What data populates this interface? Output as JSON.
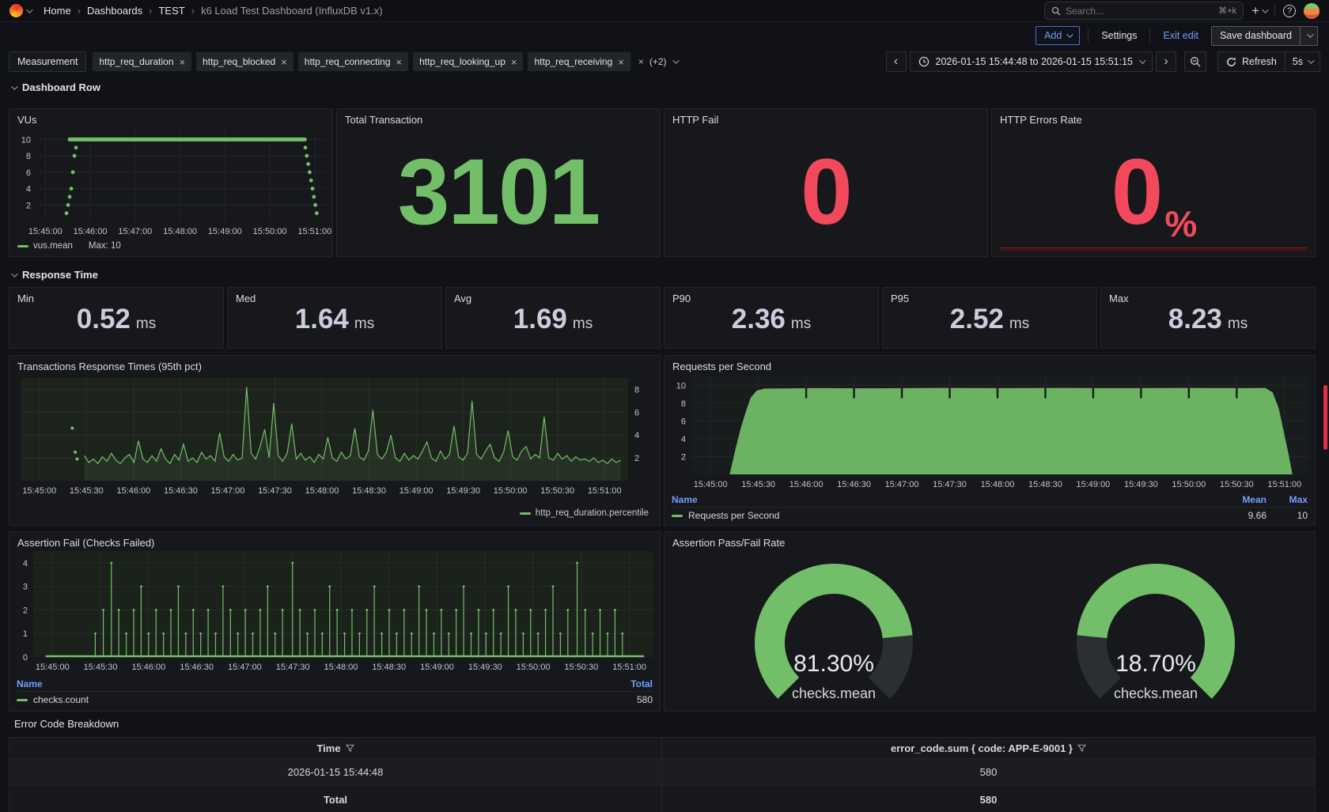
{
  "nav": {
    "breadcrumbs": [
      "Home",
      "Dashboards",
      "TEST",
      "k6 Load Test Dashboard (InfluxDB v1.x)"
    ],
    "search_placeholder": "Search...",
    "search_shortcut": "⌘+k"
  },
  "toolbar": {
    "add_label": "Add",
    "settings_label": "Settings",
    "exit_edit_label": "Exit edit",
    "save_label": "Save dashboard"
  },
  "filters": {
    "measurement_label": "Measurement",
    "chips": [
      "http_req_duration",
      "http_req_blocked",
      "http_req_connecting",
      "http_req_looking_up",
      "http_req_receiving"
    ],
    "more_label": "(+2)"
  },
  "timebar": {
    "range": "2026-01-15 15:44:48 to 2026-01-15 15:51:15",
    "refresh_label": "Refresh",
    "interval_label": "5s"
  },
  "sections": {
    "dashboard_row": "Dashboard Row",
    "response_time": "Response Time",
    "error_breakdown": "Error Code Breakdown"
  },
  "panels": {
    "vus": {
      "title": "VUs",
      "legend": "vus.mean",
      "legend_max": "Max: 10"
    },
    "total_transaction": {
      "title": "Total Transaction",
      "value": "3101"
    },
    "http_fail": {
      "title": "HTTP Fail",
      "value": "0"
    },
    "http_errors": {
      "title": "HTTP Errors Rate",
      "value": "0",
      "unit": "%"
    },
    "stats": [
      {
        "label": "Min",
        "value": "0.52",
        "unit": "ms"
      },
      {
        "label": "Med",
        "value": "1.64",
        "unit": "ms"
      },
      {
        "label": "Avg",
        "value": "1.69",
        "unit": "ms"
      },
      {
        "label": "P90",
        "value": "2.36",
        "unit": "ms"
      },
      {
        "label": "P95",
        "value": "2.52",
        "unit": "ms"
      },
      {
        "label": "Max",
        "value": "8.23",
        "unit": "ms"
      }
    ],
    "transactions": {
      "title": "Transactions Response Times (95th pct)",
      "legend": "http_req_duration.percentile"
    },
    "rps": {
      "title": "Requests per Second",
      "cols": {
        "name": "Name",
        "mean": "Mean",
        "max": "Max"
      },
      "row": {
        "name": "Requests per Second",
        "mean": "9.66",
        "max": "10"
      }
    },
    "assertion_fail": {
      "title": "Assertion Fail (Checks Failed)",
      "cols": {
        "name": "Name",
        "total": "Total"
      },
      "row": {
        "name": "checks.count",
        "total": "580"
      }
    },
    "gauge_panel": {
      "title": "Assertion Pass/Fail Rate",
      "gauges": [
        {
          "display": "81.30%",
          "label": "checks.mean"
        },
        {
          "display": "18.70%",
          "label": "checks.mean"
        }
      ]
    }
  },
  "error_table": {
    "col_time": "Time",
    "col_code": "error_code.sum { code: APP-E-9001 }",
    "row_time": "2026-01-15 15:44:48",
    "row_value": "580",
    "total_label": "Total",
    "total_value": "580"
  },
  "colors": {
    "green": "#73bf69",
    "red": "#f2495c",
    "blue": "#6e9fff"
  },
  "chart_data": [
    {
      "id": "vus",
      "type": "scatter",
      "title": "VUs",
      "x_labels": [
        "15:45:00",
        "15:46:00",
        "15:47:00",
        "15:48:00",
        "15:49:00",
        "15:50:00",
        "15:51:00"
      ],
      "x_start_s": 12,
      "x_step_s": 60,
      "x_total_s": 387,
      "y_ticks": [
        2,
        4,
        6,
        8,
        10
      ],
      "ylim": [
        0,
        11
      ],
      "plateau": {
        "t0": 0.115,
        "t1": 0.927,
        "value": 10
      },
      "ramp_up": {
        "t": 0.104,
        "values": [
          1,
          2,
          3,
          4,
          6,
          8,
          9
        ]
      },
      "ramp_down": {
        "t": 0.929,
        "values": [
          9,
          8,
          7,
          6,
          5,
          4,
          3,
          2,
          1
        ]
      },
      "series_name": "vus.mean",
      "series_max": 10
    },
    {
      "id": "percentile",
      "type": "line",
      "title": "Transactions Response Times (95th pct)",
      "x_labels": [
        "15:45:00",
        "15:45:30",
        "15:46:00",
        "15:46:30",
        "15:47:00",
        "15:47:30",
        "15:48:00",
        "15:48:30",
        "15:49:00",
        "15:49:30",
        "15:50:00",
        "15:50:30",
        "15:51:00"
      ],
      "x_start_s": 12,
      "x_step_s": 30,
      "x_total_s": 387,
      "y_ticks": [
        2,
        4,
        6,
        8
      ],
      "ylim": [
        0,
        9
      ],
      "y_axis": "right",
      "t0": 0.105,
      "t1": 0.988,
      "lead_dots": [
        [
          0.085,
          4.6
        ],
        [
          0.09,
          2.5
        ],
        [
          0.093,
          1.9
        ]
      ],
      "values": [
        2.2,
        1.6,
        1.9,
        1.5,
        2.1,
        1.7,
        2.4,
        1.8,
        1.5,
        2.0,
        2.3,
        1.6,
        3.5,
        1.9,
        1.6,
        2.2,
        1.7,
        2.8,
        1.9,
        1.5,
        2.3,
        1.8,
        3.2,
        1.7,
        2.0,
        1.6,
        2.5,
        1.9,
        2.2,
        1.7,
        4.2,
        2.1,
        1.7,
        2.3,
        1.8,
        2.0,
        8.2,
        2.4,
        1.9,
        3.0,
        4.5,
        2.0,
        6.8,
        2.2,
        1.7,
        2.4,
        5.0,
        1.9,
        2.4,
        1.8,
        2.1,
        1.6,
        2.3,
        1.9,
        3.8,
        2.0,
        1.7,
        2.5,
        1.9,
        2.2,
        4.6,
        2.1,
        1.8,
        2.6,
        6.2,
        2.3,
        1.9,
        2.5,
        4.0,
        2.0,
        1.7,
        2.4,
        1.8,
        2.2,
        1.9,
        2.6,
        3.4,
        2.0,
        1.7,
        2.6,
        1.9,
        2.3,
        4.8,
        2.1,
        1.8,
        2.4,
        7.0,
        2.3,
        1.9,
        2.6,
        3.2,
        2.0,
        1.7,
        2.5,
        4.4,
        2.1,
        1.8,
        2.6,
        3.0,
        1.9,
        2.3,
        2.0,
        5.6,
        2.0,
        1.8,
        2.4,
        1.9,
        2.2,
        1.7,
        2.1,
        1.8,
        1.9,
        1.7,
        2.0,
        1.6,
        1.8,
        1.5,
        1.9,
        1.6,
        1.8
      ],
      "series_name": "http_req_duration.percentile"
    },
    {
      "id": "rps",
      "type": "area",
      "title": "Requests per Second",
      "x_labels": [
        "15:45:00",
        "15:45:30",
        "15:46:00",
        "15:46:30",
        "15:47:00",
        "15:47:30",
        "15:48:00",
        "15:48:30",
        "15:49:00",
        "15:49:30",
        "15:50:00",
        "15:50:30",
        "15:51:00"
      ],
      "x_start_s": 12,
      "x_step_s": 30,
      "x_total_s": 387,
      "y_ticks": [
        2,
        4,
        6,
        8,
        10
      ],
      "ylim": [
        0,
        11
      ],
      "shape": [
        [
          0.062,
          0
        ],
        [
          0.072,
          3.0
        ],
        [
          0.08,
          5.2
        ],
        [
          0.088,
          7.0
        ],
        [
          0.096,
          8.6
        ],
        [
          0.106,
          9.4
        ],
        [
          0.118,
          9.62
        ],
        [
          0.2,
          9.68
        ],
        [
          0.3,
          9.66
        ],
        [
          0.4,
          9.7
        ],
        [
          0.5,
          9.68
        ],
        [
          0.6,
          9.7
        ],
        [
          0.7,
          9.68
        ],
        [
          0.8,
          9.7
        ],
        [
          0.9,
          9.68
        ],
        [
          0.93,
          9.7
        ],
        [
          0.942,
          9.2
        ],
        [
          0.952,
          7.4
        ],
        [
          0.96,
          4.8
        ],
        [
          0.968,
          2.2
        ],
        [
          0.974,
          0
        ]
      ],
      "notch_ticks": [
        2,
        3,
        4,
        5,
        6,
        7,
        8,
        9,
        10,
        11
      ],
      "mean": 9.66,
      "max": 10,
      "series_name": "Requests per Second"
    },
    {
      "id": "checks",
      "type": "spikes",
      "title": "Assertion Fail (Checks Failed)",
      "x_labels": [
        "15:45:00",
        "15:45:30",
        "15:46:00",
        "15:46:30",
        "15:47:00",
        "15:47:30",
        "15:48:00",
        "15:48:30",
        "15:49:00",
        "15:49:30",
        "15:50:00",
        "15:50:30",
        "15:51:00"
      ],
      "x_start_s": 12,
      "x_step_s": 30,
      "x_total_s": 387,
      "y_ticks": [
        0,
        1,
        2,
        3,
        4
      ],
      "ylim": [
        0,
        4.5
      ],
      "baseline": {
        "t0": 0.02,
        "t1": 0.985
      },
      "spikes": [
        [
          0.1,
          1
        ],
        [
          0.113,
          2
        ],
        [
          0.126,
          4
        ],
        [
          0.138,
          2
        ],
        [
          0.15,
          1
        ],
        [
          0.162,
          2
        ],
        [
          0.174,
          3
        ],
        [
          0.186,
          1
        ],
        [
          0.198,
          2
        ],
        [
          0.21,
          1
        ],
        [
          0.222,
          2
        ],
        [
          0.234,
          3
        ],
        [
          0.246,
          1
        ],
        [
          0.258,
          2
        ],
        [
          0.27,
          1
        ],
        [
          0.282,
          2
        ],
        [
          0.294,
          1
        ],
        [
          0.306,
          3
        ],
        [
          0.318,
          2
        ],
        [
          0.33,
          1
        ],
        [
          0.342,
          2
        ],
        [
          0.354,
          1
        ],
        [
          0.366,
          2
        ],
        [
          0.378,
          3
        ],
        [
          0.39,
          1
        ],
        [
          0.402,
          2
        ],
        [
          0.418,
          4
        ],
        [
          0.43,
          2
        ],
        [
          0.442,
          1
        ],
        [
          0.454,
          2
        ],
        [
          0.466,
          1
        ],
        [
          0.478,
          3
        ],
        [
          0.49,
          2
        ],
        [
          0.502,
          1
        ],
        [
          0.514,
          2
        ],
        [
          0.526,
          1
        ],
        [
          0.538,
          2
        ],
        [
          0.55,
          3
        ],
        [
          0.562,
          1
        ],
        [
          0.574,
          2
        ],
        [
          0.586,
          1
        ],
        [
          0.598,
          2
        ],
        [
          0.61,
          1
        ],
        [
          0.622,
          3
        ],
        [
          0.634,
          2
        ],
        [
          0.646,
          1
        ],
        [
          0.658,
          2
        ],
        [
          0.67,
          1
        ],
        [
          0.682,
          2
        ],
        [
          0.694,
          3
        ],
        [
          0.706,
          1
        ],
        [
          0.718,
          2
        ],
        [
          0.73,
          1
        ],
        [
          0.742,
          2
        ],
        [
          0.754,
          1
        ],
        [
          0.766,
          3
        ],
        [
          0.778,
          2
        ],
        [
          0.79,
          1
        ],
        [
          0.802,
          2
        ],
        [
          0.814,
          1
        ],
        [
          0.826,
          2
        ],
        [
          0.838,
          3
        ],
        [
          0.85,
          1
        ],
        [
          0.862,
          2
        ],
        [
          0.877,
          4
        ],
        [
          0.89,
          2
        ],
        [
          0.902,
          1
        ],
        [
          0.914,
          2
        ],
        [
          0.926,
          1
        ],
        [
          0.938,
          2
        ],
        [
          0.95,
          1
        ]
      ],
      "total": 580,
      "series_name": "checks.count"
    },
    {
      "id": "gauge1",
      "type": "gauge",
      "value_pct": 81.3,
      "display": "81.30%",
      "label": "checks.mean",
      "invert": false
    },
    {
      "id": "gauge2",
      "type": "gauge",
      "value_pct": 18.7,
      "display": "18.70%",
      "label": "checks.mean",
      "invert": true
    }
  ]
}
